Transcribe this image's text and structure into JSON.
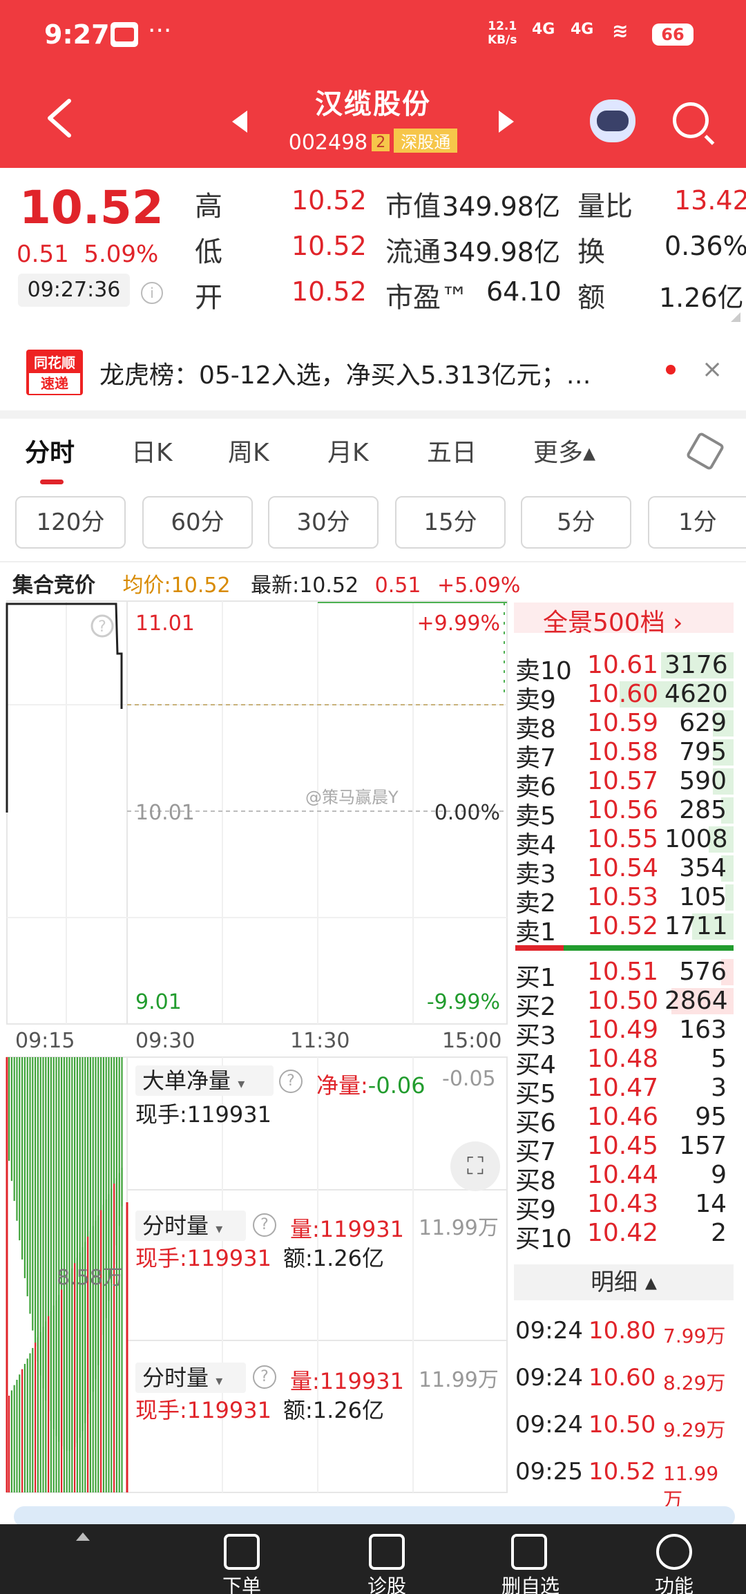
{
  "status_bar": {
    "time": "9:27",
    "dots": "···",
    "net_speed": "12.1\nKB/s",
    "signal1": "4G",
    "signal2": "4G",
    "battery": "66"
  },
  "header": {
    "title": "汉缆股份",
    "code": "002498",
    "badge": "2",
    "tag": "深股通"
  },
  "quote": {
    "price": "10.52",
    "change": "0.51",
    "change_pct": "5.09%",
    "time": "09:27:36",
    "high_label": "高",
    "high": "10.52",
    "low_label": "低",
    "low": "10.52",
    "open_label": "开",
    "open": "10.52",
    "mcap_label": "市值",
    "mcap": "349.98亿",
    "float_label": "流通",
    "float": "349.98亿",
    "pe_label": "市盈™",
    "pe": "64.10",
    "vr_label": "量比",
    "vr": "13.42",
    "turnover_label": "换",
    "turnover": "0.36%",
    "amount_label": "额",
    "amount": "1.26亿"
  },
  "news": {
    "logo_top": "同花顺",
    "logo_bottom": "速递",
    "text": "龙虎榜：05-12入选，净买入5.313亿元；…",
    "close": "×"
  },
  "tabs": [
    "分时",
    "日K",
    "周K",
    "月K",
    "五日",
    "更多▴"
  ],
  "periods": [
    "120分",
    "60分",
    "30分",
    "15分",
    "5分",
    "1分"
  ],
  "chart_header": {
    "auction": "集合竞价",
    "avg": "均价:10.52",
    "latest": "最新:10.52",
    "chg": "0.51",
    "chg_pct": "+5.09%"
  },
  "chart": {
    "y_top": "11.01",
    "y_mid": "10.01",
    "y_bot": "9.01",
    "pct_top": "+9.99%",
    "pct_mid": "0.00%",
    "pct_bot": "-9.99%",
    "x_labels": [
      "09:15",
      "09:30",
      "11:30",
      "15:00"
    ],
    "watermark": "@策马赢晨Y"
  },
  "sub_charts": {
    "big_order": {
      "label": "大单净量",
      "net_label": "净量:",
      "net_value": "-0.06",
      "right": "-0.05",
      "hand": "现手:119931"
    },
    "left_vol": "8.58万",
    "vol1": {
      "label": "分时量",
      "vol": "量:119931",
      "hand": "现手:119931",
      "amt": "额:1.26亿",
      "right": "11.99万"
    },
    "vol2": {
      "label": "分时量",
      "vol": "量:119931",
      "hand": "现手:119931",
      "amt": "额:1.26亿",
      "right": "11.99万"
    }
  },
  "order_book": {
    "panorama": "全景500档",
    "asks": [
      {
        "label": "卖10",
        "price": "10.61",
        "vol": "3176",
        "bar": 0.35
      },
      {
        "label": "卖9",
        "price": "10.60",
        "vol": "4620",
        "bar": 0.55
      },
      {
        "label": "卖8",
        "price": "10.59",
        "vol": "629",
        "bar": 0.1
      },
      {
        "label": "卖7",
        "price": "10.58",
        "vol": "795",
        "bar": 0.1
      },
      {
        "label": "卖6",
        "price": "10.57",
        "vol": "590",
        "bar": 0.1
      },
      {
        "label": "卖5",
        "price": "10.56",
        "vol": "285",
        "bar": 0.06
      },
      {
        "label": "卖4",
        "price": "10.55",
        "vol": "1008",
        "bar": 0.12
      },
      {
        "label": "卖3",
        "price": "10.54",
        "vol": "354",
        "bar": 0.06
      },
      {
        "label": "卖2",
        "price": "10.53",
        "vol": "105",
        "bar": 0.04
      },
      {
        "label": "卖1",
        "price": "10.52",
        "vol": "1711",
        "bar": 0.2
      }
    ],
    "bids": [
      {
        "label": "买1",
        "price": "10.51",
        "vol": "576",
        "bar": 0.06
      },
      {
        "label": "买2",
        "price": "10.50",
        "vol": "2864",
        "bar": 0.3
      },
      {
        "label": "买3",
        "price": "10.49",
        "vol": "163",
        "bar": 0
      },
      {
        "label": "买4",
        "price": "10.48",
        "vol": "5",
        "bar": 0
      },
      {
        "label": "买5",
        "price": "10.47",
        "vol": "3",
        "bar": 0
      },
      {
        "label": "买6",
        "price": "10.46",
        "vol": "95",
        "bar": 0
      },
      {
        "label": "买7",
        "price": "10.45",
        "vol": "157",
        "bar": 0
      },
      {
        "label": "买8",
        "price": "10.44",
        "vol": "9",
        "bar": 0
      },
      {
        "label": "买9",
        "price": "10.43",
        "vol": "14",
        "bar": 0
      },
      {
        "label": "买10",
        "price": "10.42",
        "vol": "2",
        "bar": 0
      }
    ],
    "detail_label": "明细 ▴",
    "details": [
      {
        "time": "09:24",
        "price": "10.80",
        "vol": "7.99万"
      },
      {
        "time": "09:24",
        "price": "10.60",
        "vol": "8.29万"
      },
      {
        "time": "09:24",
        "price": "10.50",
        "vol": "9.29万"
      },
      {
        "time": "09:25",
        "price": "10.52",
        "vol": "11.99万"
      }
    ]
  },
  "bottom_nav": [
    "下单",
    "诊股",
    "删自选",
    "功能"
  ],
  "colors": {
    "brand_red": "#ef3a3f",
    "up": "#e0242a",
    "down": "#229c2e"
  }
}
